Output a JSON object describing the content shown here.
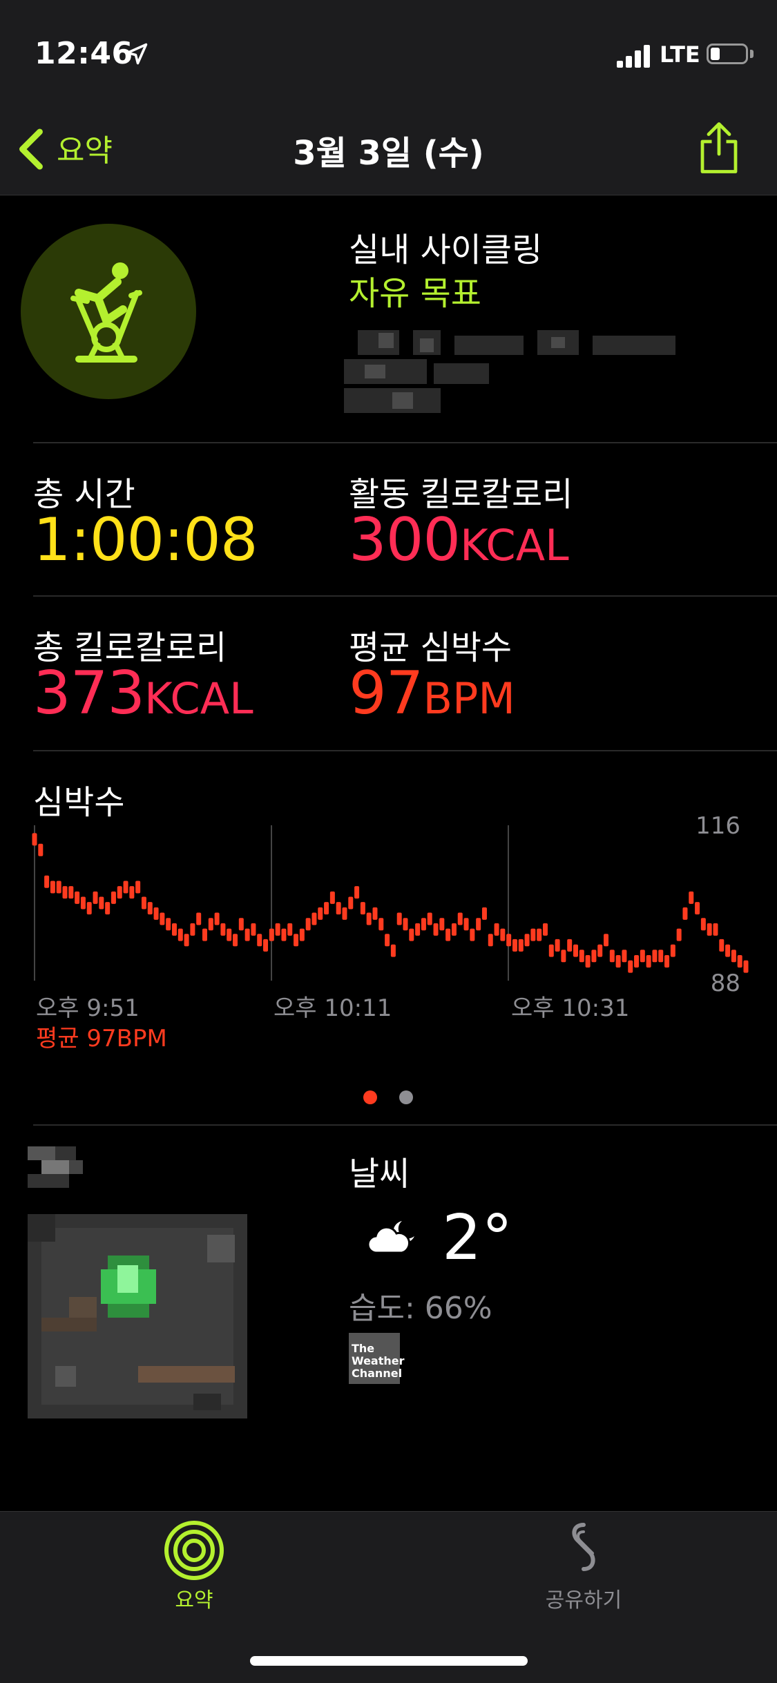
{
  "status_bar": {
    "time": "12:46",
    "network": "LTE"
  },
  "nav": {
    "back_label": "요약",
    "title": "3월 3일 (수)"
  },
  "workout": {
    "title": "실내 사이클링",
    "goal": "자유 목표"
  },
  "stats": [
    {
      "label": "총 시간",
      "value": "1:00:08",
      "unit": "",
      "color": "#ffe119"
    },
    {
      "label": "활동 킬로칼로리",
      "value": "300",
      "unit": "KCAL",
      "color": "#ff2d55"
    },
    {
      "label": "총 킬로칼로리",
      "value": "373",
      "unit": "KCAL",
      "color": "#ff2d55"
    },
    {
      "label": "평균 심박수",
      "value": "97",
      "unit": "BPM",
      "color": "#ff3b1f"
    }
  ],
  "heart_chart": {
    "title": "심박수",
    "y_max_label": "116",
    "y_min_label": "88",
    "x_labels": [
      "오후 9:51",
      "오후 10:11",
      "오후 10:31"
    ],
    "average_label": "평균 97BPM"
  },
  "chart_data": {
    "type": "scatter",
    "title": "심박수",
    "ylim": [
      88,
      116
    ],
    "x_labels": [
      "오후 9:51",
      "오후 10:11",
      "오후 10:31"
    ],
    "series": [
      {
        "values": [
          114,
          112,
          106,
          105,
          105,
          104,
          104,
          103,
          102,
          101,
          103,
          102,
          101,
          103,
          104,
          105,
          104,
          105,
          102,
          101,
          100,
          99,
          98,
          97,
          96,
          95,
          97,
          99,
          96,
          98,
          99,
          97,
          96,
          95,
          98,
          96,
          97,
          95,
          94,
          96,
          97,
          96,
          97,
          95,
          96,
          98,
          99,
          100,
          101,
          103,
          101,
          100,
          102,
          104,
          101,
          99,
          100,
          98,
          95,
          93,
          99,
          98,
          96,
          97,
          98,
          99,
          97,
          98,
          96,
          97,
          99,
          98,
          96,
          98,
          100,
          95,
          97,
          96,
          95,
          94,
          94,
          95,
          96,
          96,
          97,
          93,
          94,
          92,
          94,
          93,
          92,
          91,
          92,
          93,
          95,
          92,
          91,
          92,
          90,
          91,
          92,
          91,
          92,
          92,
          91,
          93,
          96,
          100,
          103,
          101,
          98,
          97,
          97,
          94,
          93,
          92,
          91,
          90
        ]
      }
    ]
  },
  "pager": {
    "active_color": "#ff3b1f",
    "inactive_color": "#8e8e93"
  },
  "weather": {
    "title": "날씨",
    "temperature": "2°",
    "humidity": "습도: 66%",
    "provider": "The Weather Channel"
  },
  "tabs": [
    {
      "label": "요약",
      "icon": "activity-rings-icon",
      "active": true
    },
    {
      "label": "공유하기",
      "icon": "sharing-icon",
      "active": false
    }
  ],
  "colors": {
    "accent": "#b4f02f",
    "heart": "#ff3b1f",
    "kcal": "#ff2d55",
    "time": "#ffe119"
  }
}
